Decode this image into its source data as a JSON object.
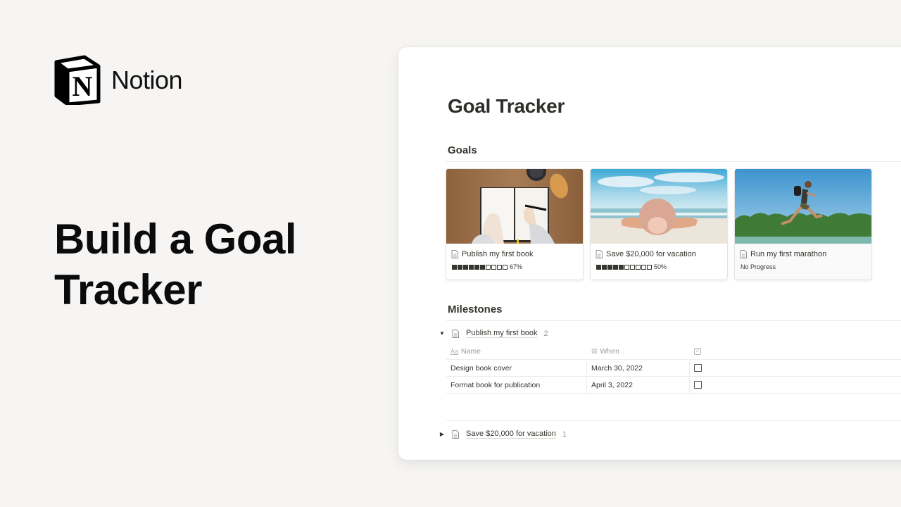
{
  "brand": {
    "name": "Notion",
    "logo_letter": "N"
  },
  "hero": {
    "line1": "Build a Goal",
    "line2": "Tracker"
  },
  "page": {
    "title": "Goal Tracker",
    "goals_heading": "Goals",
    "milestones_heading": "Milestones"
  },
  "goals": [
    {
      "title": "Publish my first book",
      "progress_percent": 67,
      "progress_label": "67%",
      "filled_blocks": 6,
      "total_blocks": 10,
      "cover": "writing-notebook-photo"
    },
    {
      "title": "Save $20,000 for vacation",
      "progress_percent": 50,
      "progress_label": "50%",
      "filled_blocks": 5,
      "total_blocks": 10,
      "cover": "beach-hat-photo"
    },
    {
      "title": "Run my first marathon",
      "progress_label": "No Progress",
      "cover": "runner-photo"
    }
  ],
  "milestones": {
    "groups": [
      {
        "title": "Publish my first book",
        "count": "2",
        "expanded": true,
        "columns": {
          "name": "Name",
          "when": "When",
          "done_icon": "checkbox-icon"
        },
        "rows": [
          {
            "name": "Design book cover",
            "when": "March 30, 2022",
            "done": false
          },
          {
            "name": "Format book for publication",
            "when": "April 3, 2022",
            "done": false
          }
        ]
      },
      {
        "title": "Save $20,000 for vacation",
        "count": "1",
        "expanded": false
      }
    ]
  },
  "colors": {
    "background": "#f6f5f3",
    "text": "#37352f",
    "muted": "#9b9a97"
  }
}
